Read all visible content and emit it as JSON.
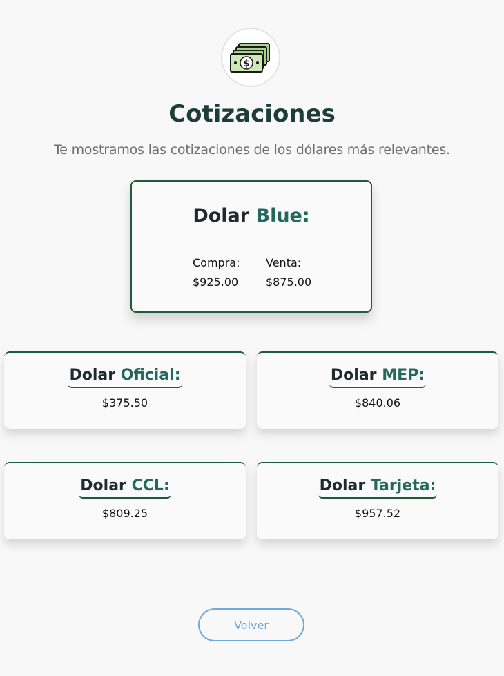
{
  "header": {
    "icon": "money-bills-icon",
    "title": "Cotizaciones",
    "subtitle": "Te mostramos las cotizaciones de los dólares más relevantes."
  },
  "colors": {
    "accent": "#23695b",
    "card_border": "#1f5a3c",
    "button": "#6fa8dc"
  },
  "main_card": {
    "prefix": "Dolar",
    "name": "Blue:",
    "compra_label": "Compra:",
    "compra_value": "$925.00",
    "venta_label": "Venta:",
    "venta_value": "$875.00"
  },
  "cards": {
    "oficial": {
      "prefix": "Dolar",
      "name": "Oficial:",
      "value": "$375.50"
    },
    "mep": {
      "prefix": "Dolar",
      "name": "MEP:",
      "value": "$840.06"
    },
    "ccl": {
      "prefix": "Dolar",
      "name": "CCL:",
      "value": "$809.25"
    },
    "tarjeta": {
      "prefix": "Dolar",
      "name": "Tarjeta:",
      "value": "$957.52"
    }
  },
  "footer": {
    "back_label": "Volver"
  }
}
